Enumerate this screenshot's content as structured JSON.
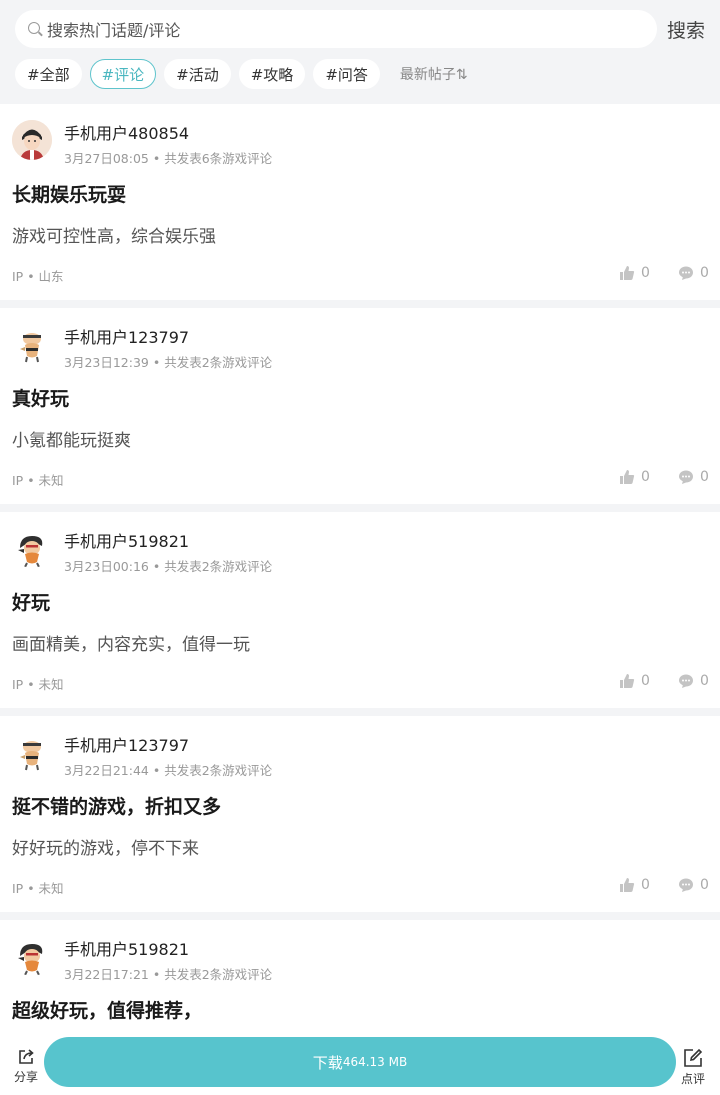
{
  "search": {
    "placeholder": "搜索热门话题/评论",
    "button": "搜索"
  },
  "tags": [
    "#全部",
    "#评论",
    "#活动",
    "#攻略",
    "#问答"
  ],
  "active_tag": "#评论",
  "sort_label": "最新帖子",
  "posts": [
    {
      "username": "手机用户480854",
      "date": "3月27日08:05",
      "meta_suffix": " • 共发表6条游戏评论",
      "title": "长期娱乐玩耍",
      "content": "游戏可控性高，综合娱乐强",
      "ip": "IP • 山东",
      "likes": "0",
      "comments": "0"
    },
    {
      "username": "手机用户123797",
      "date": "3月23日12:39",
      "meta_suffix": " • 共发表2条游戏评论",
      "title": "真好玩",
      "content": "小氪都能玩挺爽",
      "ip": "IP • 未知",
      "likes": "0",
      "comments": "0"
    },
    {
      "username": "手机用户519821",
      "date": "3月23日00:16",
      "meta_suffix": " • 共发表2条游戏评论",
      "title": "好玩",
      "content": "画面精美，内容充实，值得一玩",
      "ip": "IP • 未知",
      "likes": "0",
      "comments": "0"
    },
    {
      "username": "手机用户123797",
      "date": "3月22日21:44",
      "meta_suffix": " • 共发表2条游戏评论",
      "title": "挺不错的游戏，折扣又多",
      "content": "好好玩的游戏，停不下来",
      "ip": "IP • 未知",
      "likes": "0",
      "comments": "0"
    },
    {
      "username": "手机用户519821",
      "date": "3月22日17:21",
      "meta_suffix": " • 共发表2条游戏评论",
      "title": "超级好玩，值得推荐，",
      "content": "",
      "ip": "",
      "likes": "",
      "comments": ""
    }
  ],
  "footer": {
    "share_label": "分享",
    "download_label": "下载",
    "download_size": "464.13 MB",
    "review_label": "点评"
  },
  "colors": {
    "accent": "#57c4cd",
    "background": "#f3f4f6"
  },
  "icons": {
    "search": "search-icon",
    "like": "thumbs-up-icon",
    "comment": "comment-bubble-icon",
    "share": "share-icon",
    "review": "edit-icon"
  }
}
